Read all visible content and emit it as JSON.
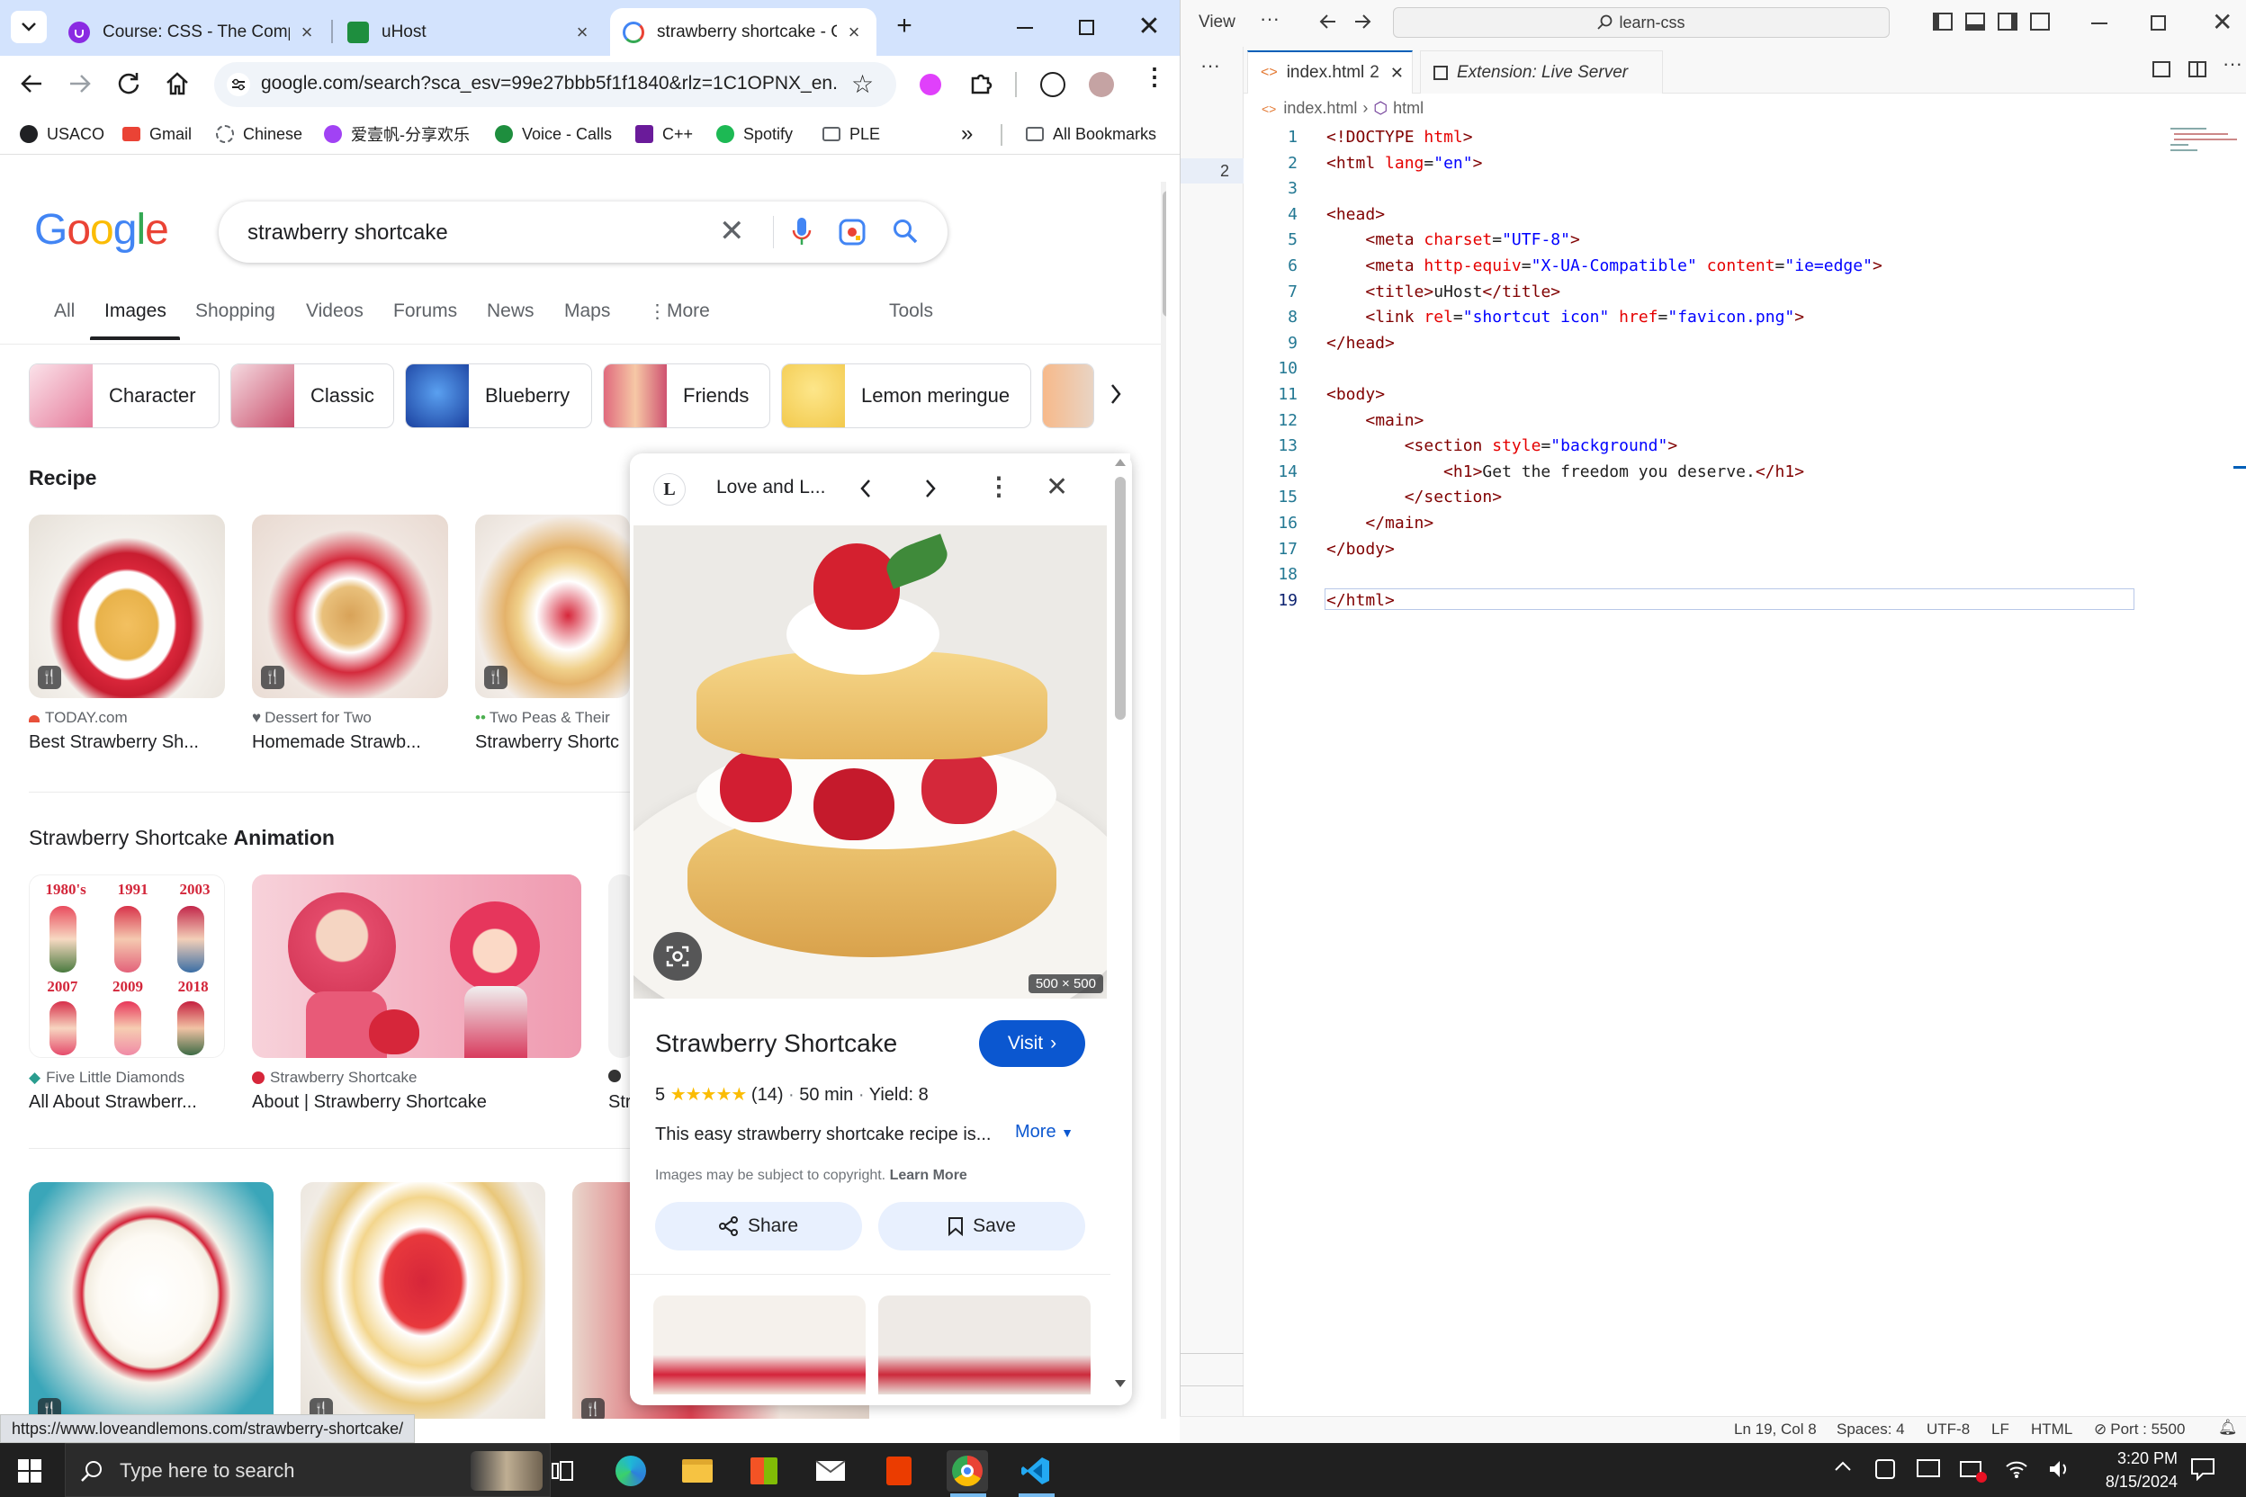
{
  "browser": {
    "tabs": [
      {
        "title": "Course: CSS - The Compl",
        "favicon_color": "#8a2be2"
      },
      {
        "title": "uHost",
        "favicon_color": "#1e8e3e"
      },
      {
        "title": "strawberry shortcake - Go",
        "favicon_color": "#4285f4",
        "active": true
      }
    ],
    "address": "google.com/search?sca_esv=99e27bbb5f1f1840&rlz=1C1OPNX_en...",
    "bookmarks": [
      {
        "label": "USACO",
        "color": "#202124"
      },
      {
        "label": "Gmail",
        "color": "#ea4335"
      },
      {
        "label": "Chinese",
        "color": "#5f6368"
      },
      {
        "label": "爱壹帆-分享欢乐",
        "color": "#a142f4"
      },
      {
        "label": "Voice - Calls",
        "color": "#1e8e3e"
      },
      {
        "label": "C++",
        "color": "#6a1b9a"
      },
      {
        "label": "Spotify",
        "color": "#1db954"
      },
      {
        "label": "PLE",
        "color": "#5f6368"
      }
    ],
    "all_bookmarks": "All Bookmarks",
    "status_url": "https://www.loveandlemons.com/strawberry-shortcake/"
  },
  "google": {
    "logo": "Google",
    "query": "strawberry shortcake",
    "tabs": [
      "All",
      "Images",
      "Shopping",
      "Videos",
      "Forums",
      "News",
      "Maps",
      "More"
    ],
    "active_tab": "Images",
    "tools": "Tools",
    "chips": [
      "Character",
      "Classic",
      "Blueberry",
      "Friends",
      "Lemon meringue"
    ],
    "sections": {
      "recipe": "Recipe",
      "animation_prefix": "Strawberry Shortcake ",
      "animation_bold": "Animation"
    },
    "recipe_cards": [
      {
        "source": "TODAY.com",
        "title": "Best Strawberry Sh..."
      },
      {
        "source": "Dessert for Two",
        "title": "Homemade Strawb..."
      },
      {
        "source": "Two Peas & Their",
        "title": "Strawberry Shortc"
      }
    ],
    "animation_cards": [
      {
        "source": "Five Little Diamonds",
        "title": "All About Strawberr...",
        "years": [
          "1980's",
          "1991",
          "2003",
          "2007",
          "2009",
          "2018"
        ]
      },
      {
        "source": "Strawberry Shortcake",
        "title": "About | Strawberry Shortcake"
      },
      {
        "source": "",
        "title": "Str"
      }
    ]
  },
  "panel": {
    "site": "Love and L...",
    "site_letter": "L",
    "image_size": "500 × 500",
    "title": "Strawberry Shortcake",
    "visit": "Visit",
    "rating_value": "5",
    "stars": 5,
    "reviews": "(14)",
    "time": "50 min",
    "yield": "Yield: 8",
    "description": "This easy strawberry shortcake recipe is...",
    "more": "More",
    "copyright": "Images may be subject to copyright.",
    "learn_more": "Learn More",
    "share": "Share",
    "save": "Save"
  },
  "vscode": {
    "menu_view": "View",
    "search": "learn-css",
    "tabs": [
      {
        "label": "index.html",
        "badge": "2",
        "active": true
      },
      {
        "label": "Extension: Live Server",
        "active": false
      }
    ],
    "breadcrumb": [
      "index.html",
      "html"
    ],
    "left_badge": "2",
    "lines": [
      "<!DOCTYPE html>",
      "<html lang=\"en\">",
      "",
      "<head>",
      "    <meta charset=\"UTF-8\">",
      "    <meta http-equiv=\"X-UA-Compatible\" content=\"ie=edge\">",
      "    <title>uHost</title>",
      "    <link rel=\"shortcut icon\" href=\"favicon.png\">",
      "</head>",
      "",
      "<body>",
      "    <main>",
      "        <section style=\"background\">",
      "            <h1>Get the freedom you deserve.</h1>",
      "        </section>",
      "    </main>",
      "</body>",
      "",
      "</html>"
    ],
    "status": {
      "position": "Ln 19, Col 8",
      "spaces": "Spaces: 4",
      "encoding": "UTF-8",
      "eol": "LF",
      "language": "HTML",
      "port": "Port : 5500"
    }
  },
  "taskbar": {
    "search_placeholder": "Type here to search",
    "time": "3:20 PM",
    "date": "8/15/2024"
  }
}
